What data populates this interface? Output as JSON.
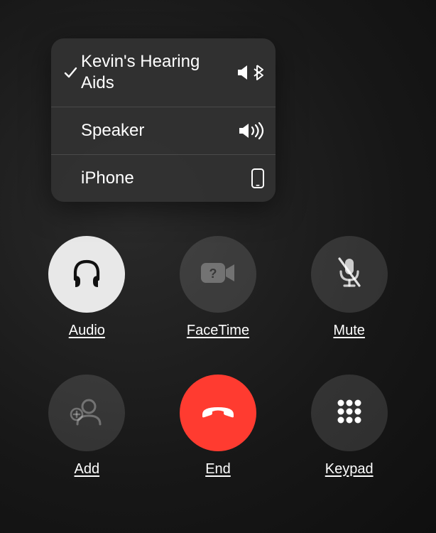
{
  "audioRoutes": {
    "items": [
      {
        "label": "Kevin's Hearing Aids",
        "selected": true,
        "iconName": "speaker-bluetooth-icon"
      },
      {
        "label": "Speaker",
        "selected": false,
        "iconName": "speaker-waves-icon"
      },
      {
        "label": "iPhone",
        "selected": false,
        "iconName": "iphone-icon"
      }
    ]
  },
  "callButtons": {
    "audio": {
      "label": "Audio"
    },
    "facetime": {
      "label": "FaceTime"
    },
    "mute": {
      "label": "Mute"
    },
    "add": {
      "label": "Add"
    },
    "end": {
      "label": "End"
    },
    "keypad": {
      "label": "Keypad"
    }
  },
  "colors": {
    "endCall": "#ff3b30",
    "popup": "#323232"
  }
}
